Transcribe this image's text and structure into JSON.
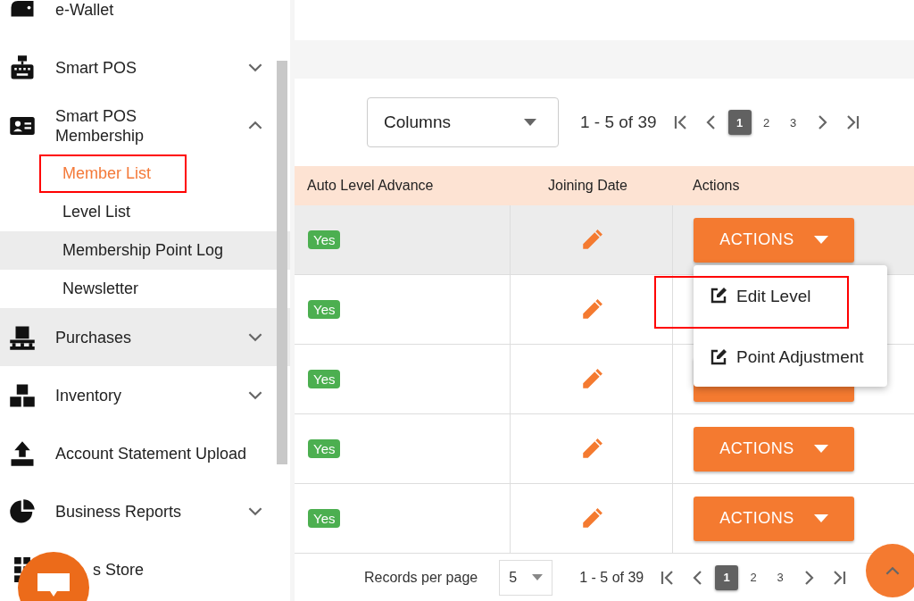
{
  "sidebar": {
    "items": [
      {
        "label": "e-Wallet"
      },
      {
        "label": "Smart POS",
        "expanded": false
      },
      {
        "label": "Smart POS Membership",
        "expanded": true,
        "children": [
          {
            "label": "Member List",
            "selected": true,
            "annotated": true,
            "hovered": false
          },
          {
            "label": "Level List",
            "selected": false,
            "annotated": false,
            "hovered": false
          },
          {
            "label": "Membership Point Log",
            "selected": false,
            "annotated": false,
            "hovered": true
          },
          {
            "label": "Newsletter",
            "selected": false,
            "annotated": false,
            "hovered": false
          }
        ]
      },
      {
        "label": "Purchases",
        "expanded": false,
        "hovered": true
      },
      {
        "label": "Inventory",
        "expanded": false
      },
      {
        "label": "Account Statement Upload"
      },
      {
        "label": "Business Reports",
        "expanded": false
      },
      {
        "label": "s Store"
      }
    ]
  },
  "toolbar": {
    "columns_select": "Columns",
    "range": "1 - 5 of 39",
    "pages": [
      {
        "label": "1",
        "selected": true
      },
      {
        "label": "2",
        "selected": false
      },
      {
        "label": "3",
        "selected": false
      }
    ]
  },
  "table": {
    "columns": [
      "Auto Level Advance",
      "Joining Date",
      "Actions"
    ],
    "rows": [
      {
        "auto_level_advance": "Yes",
        "actions": "ACTIONS",
        "highlighted": true
      },
      {
        "auto_level_advance": "Yes",
        "highlighted": false
      },
      {
        "auto_level_advance": "Yes",
        "action_button": true,
        "highlighted": false
      },
      {
        "auto_level_advance": "Yes",
        "actions": "ACTIONS",
        "highlighted": false
      },
      {
        "auto_level_advance": "Yes",
        "actions": "ACTIONS",
        "highlighted": false
      }
    ]
  },
  "actions_menu": [
    {
      "label": "Edit Level",
      "annotated": true
    },
    {
      "label": "Point Adjustment",
      "annotated": false
    }
  ],
  "footer": {
    "label": "Records per page",
    "page_size": "5",
    "range": "1 - 5 of 39",
    "pages": [
      {
        "label": "1",
        "selected": true
      },
      {
        "label": "2",
        "selected": false
      },
      {
        "label": "3",
        "selected": false
      }
    ]
  }
}
